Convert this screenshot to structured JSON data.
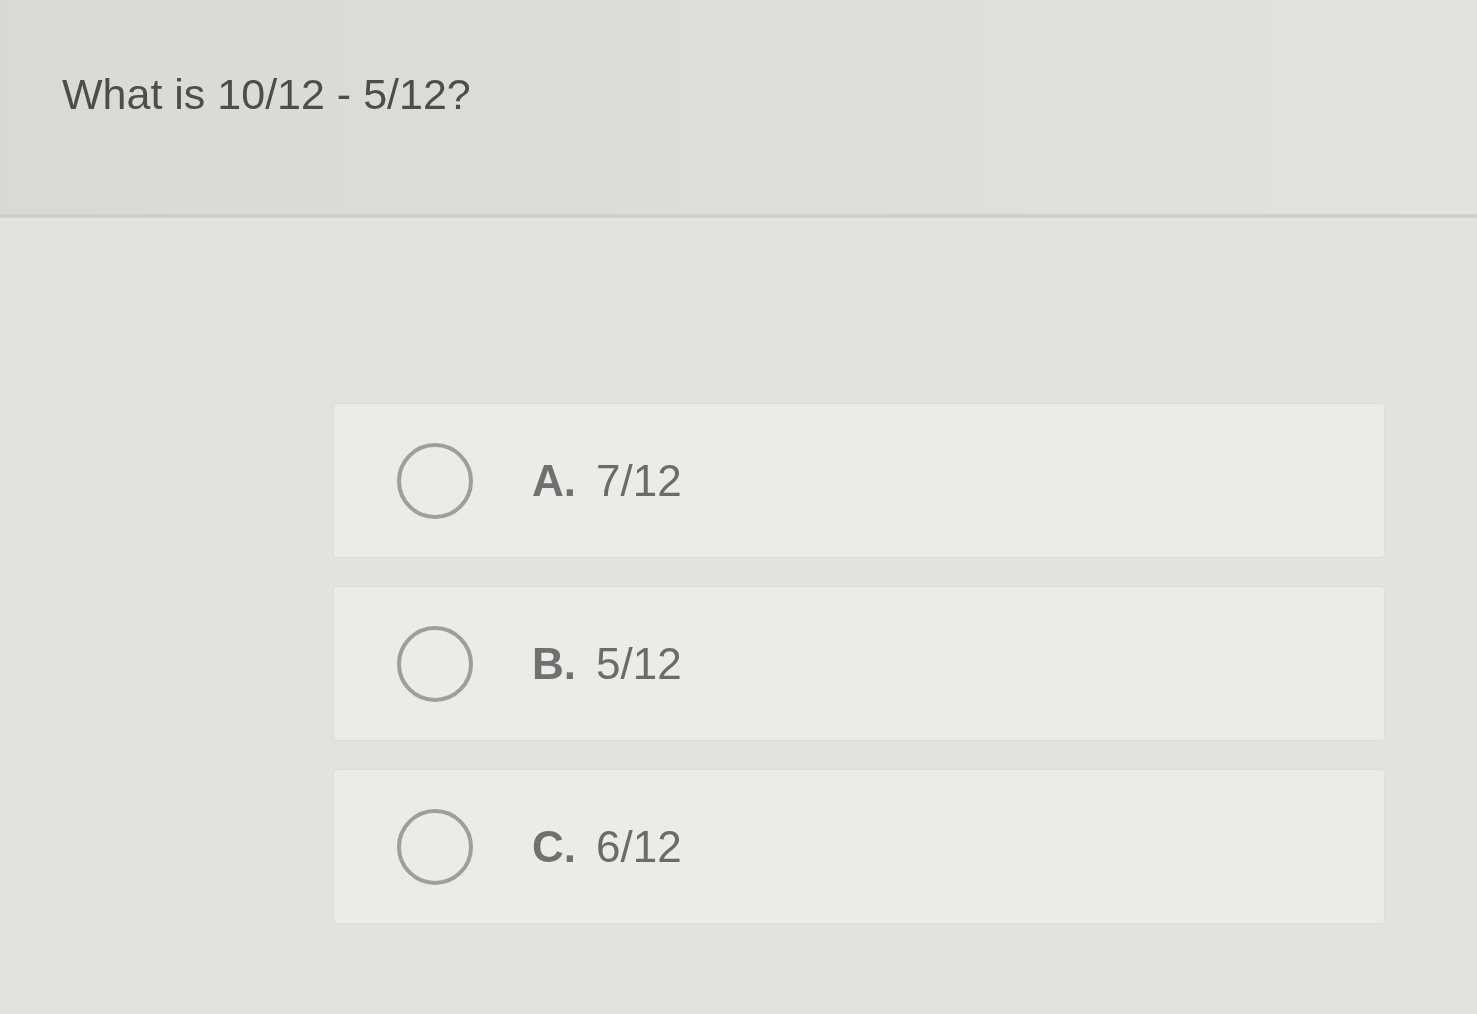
{
  "question": {
    "text": "What is 10/12 - 5/12?"
  },
  "options": [
    {
      "letter": "A.",
      "text": "7/12",
      "selected": false
    },
    {
      "letter": "B.",
      "text": "5/12",
      "selected": false
    },
    {
      "letter": "C.",
      "text": "6/12",
      "selected": false
    }
  ]
}
